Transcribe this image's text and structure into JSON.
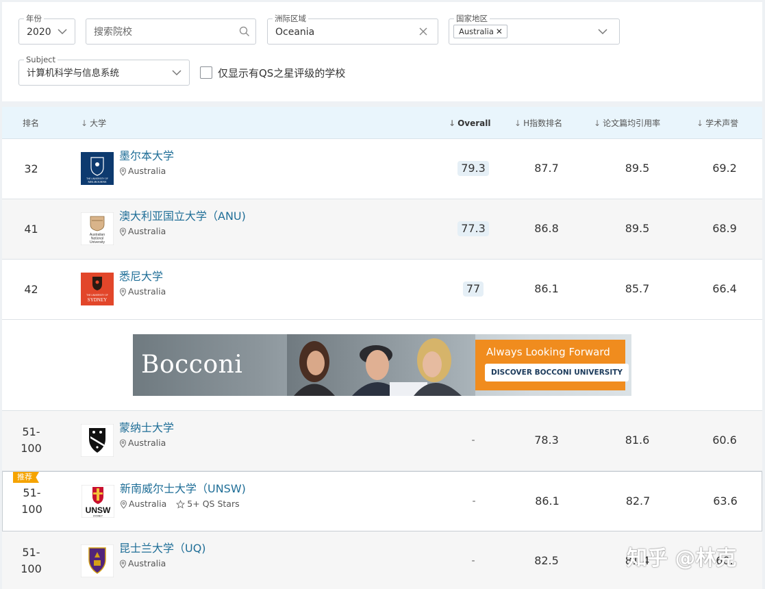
{
  "filters": {
    "year": {
      "label": "年份",
      "value": "2020"
    },
    "search": {
      "placeholder": "搜索院校"
    },
    "region": {
      "label": "洲际区域",
      "value": "Oceania"
    },
    "country": {
      "label": "国家地区",
      "chip": "Australia",
      "chip_remove": "✕"
    },
    "subject": {
      "label": "Subject",
      "value": "计算机科学与信息系统"
    },
    "qs_stars_only": {
      "label": "仅显示有QS之星评级的学校",
      "checked": false
    }
  },
  "table": {
    "headers": {
      "rank": "排名",
      "university": "大学",
      "overall": "Overall",
      "h_index": "H指数排名",
      "citations": "论文篇均引用率",
      "reputation": "学术声誉",
      "sort_arrow": "↓"
    },
    "rows": [
      {
        "rank": "32",
        "name": "墨尔本大学",
        "country": "Australia",
        "overall": "79.3",
        "h_index": "87.7",
        "citations": "89.5",
        "reputation": "69.2"
      },
      {
        "rank": "41",
        "name": "澳大利亚国立大学（ANU)",
        "country": "Australia",
        "overall": "77.3",
        "h_index": "86.8",
        "citations": "89.5",
        "reputation": "68.9"
      },
      {
        "rank": "42",
        "name": "悉尼大学",
        "country": "Australia",
        "overall": "77",
        "h_index": "86.1",
        "citations": "85.7",
        "reputation": "66.4"
      },
      {
        "rank_line1": "51-",
        "rank_line2": "100",
        "name": "蒙纳士大学",
        "country": "Australia",
        "overall": "-",
        "h_index": "78.3",
        "citations": "81.6",
        "reputation": "60.6"
      },
      {
        "badge": "推荐",
        "rank_line1": "51-",
        "rank_line2": "100",
        "name": "新南威尔士大学（UNSW)",
        "country": "Australia",
        "stars": "5+ QS Stars",
        "overall": "-",
        "h_index": "86.1",
        "citations": "82.7",
        "reputation": "63.6"
      },
      {
        "rank_line1": "51-",
        "rank_line2": "100",
        "name": "昆士兰大学（UQ)",
        "country": "Australia",
        "overall": "-",
        "h_index": "82.5",
        "citations": "81.4",
        "reputation": "60."
      }
    ]
  },
  "logos": {
    "melbourne": {
      "line1": "THE UNIVERSITY OF",
      "line2": "MELBOURNE"
    },
    "anu": {
      "line1": "Australian",
      "line2": "National",
      "line3": "University"
    },
    "sydney": {
      "line1": "THE UNIVERSITY OF",
      "line2": "SYDNEY"
    },
    "unsw": {
      "line1": "UNSW",
      "line2": "SYDNEY"
    }
  },
  "ad": {
    "brand": "Bocconi",
    "tagline": "Always Looking Forward",
    "cta": "DISCOVER BOCCONI UNIVERSITY"
  },
  "watermark": "知乎 @林克",
  "colors": {
    "link": "#1f6e97",
    "header_bg": "#e9f5fc",
    "badge": "#f5a300",
    "ad_orange": "#f08c1e"
  }
}
